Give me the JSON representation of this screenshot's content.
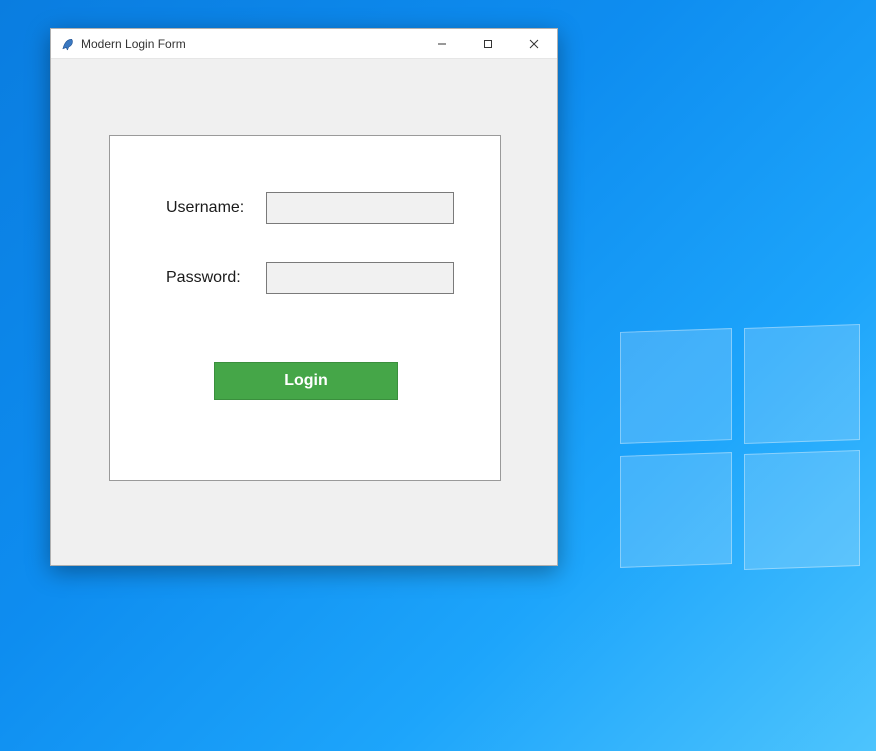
{
  "window": {
    "title": "Modern Login Form"
  },
  "form": {
    "username_label": "Username:",
    "password_label": "Password:",
    "username_value": "",
    "password_value": ""
  },
  "buttons": {
    "login_label": "Login"
  }
}
